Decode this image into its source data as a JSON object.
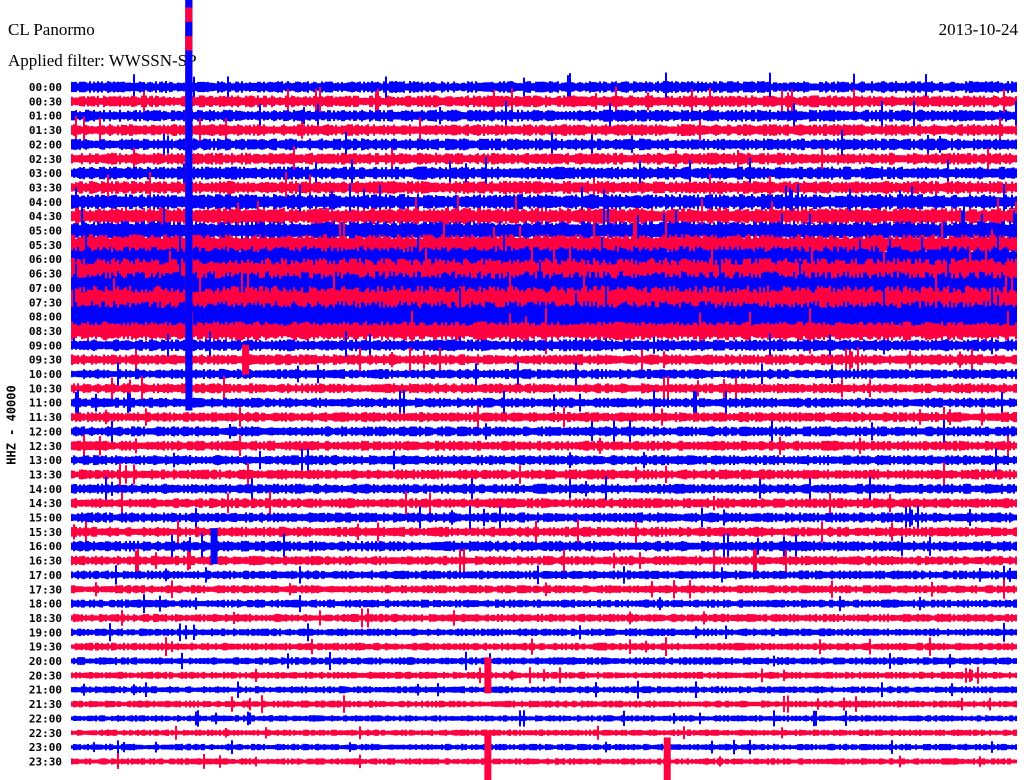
{
  "header": {
    "station": "CL Panormo",
    "filter": "Applied filter: WWSSN-SP",
    "date": "2013-10-24"
  },
  "chart_data": {
    "type": "line",
    "subtype": "helicorder",
    "title": "CL Panormo",
    "ylabel": "HHZ - 40000",
    "row_minutes": 30,
    "colors": [
      "#0000ff",
      "#ff0040"
    ],
    "rows": [
      "00:00",
      "00:30",
      "01:00",
      "01:30",
      "02:00",
      "02:30",
      "03:00",
      "03:30",
      "04:00",
      "04:30",
      "05:00",
      "05:30",
      "06:00",
      "06:30",
      "07:00",
      "07:30",
      "08:00",
      "08:30",
      "09:00",
      "09:30",
      "10:00",
      "10:30",
      "11:00",
      "11:30",
      "12:00",
      "12:30",
      "13:00",
      "13:30",
      "14:00",
      "14:30",
      "15:00",
      "15:30",
      "16:00",
      "16:30",
      "17:00",
      "17:30",
      "18:00",
      "18:30",
      "19:00",
      "19:30",
      "20:00",
      "20:30",
      "21:00",
      "21:30",
      "22:00",
      "22:30",
      "23:00",
      "23:30"
    ],
    "relative_amplitude": [
      1.0,
      1.0,
      1.0,
      1.0,
      1.0,
      1.0,
      1.1,
      1.1,
      1.3,
      1.4,
      1.6,
      1.8,
      2.2,
      2.6,
      2.8,
      2.8,
      2.6,
      1.6,
      1.0,
      0.9,
      0.85,
      0.85,
      0.85,
      0.85,
      0.85,
      0.85,
      0.85,
      0.85,
      0.85,
      0.85,
      0.85,
      0.85,
      0.9,
      0.8,
      0.75,
      0.7,
      0.7,
      0.7,
      0.65,
      0.65,
      0.65,
      0.6,
      0.6,
      0.6,
      0.55,
      0.55,
      0.55,
      0.55
    ],
    "events": [
      {
        "row": 0,
        "minute": 3.7,
        "amplitude": 30,
        "rows_span": 11
      },
      {
        "row": 32,
        "minute": 4.5,
        "amplitude": 3
      },
      {
        "row": 47,
        "minute": 13.2,
        "amplitude": 5
      },
      {
        "row": 47,
        "minute": 18.9,
        "amplitude": 4
      },
      {
        "row": 41,
        "minute": 13.2,
        "amplitude": 3
      },
      {
        "row": 19,
        "minute": 5.5,
        "amplitude": 2.5
      }
    ]
  }
}
